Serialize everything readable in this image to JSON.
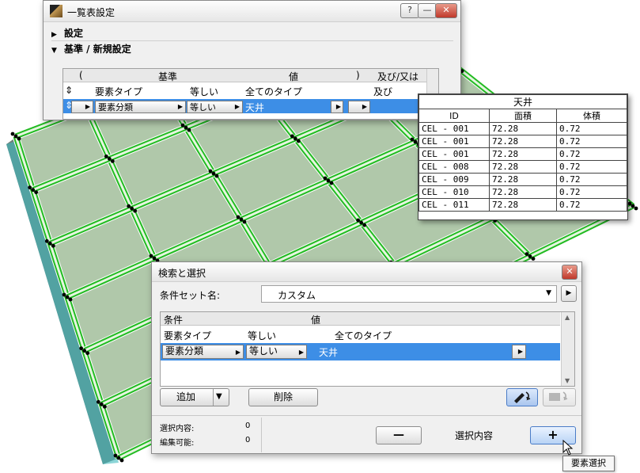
{
  "list_window": {
    "title": "一覧表設定",
    "help_label": "?",
    "minimize_label": "—",
    "close_label": "✕",
    "settings_label": "設定",
    "criteria_label": "基準 / 新規設定",
    "grid_header": {
      "paren_open": "(",
      "criteria": "基準",
      "value": "値",
      "paren_close": ")",
      "and_or": "及び/又は"
    },
    "rows": [
      {
        "sort": "⇕",
        "element_type": "要素タイプ",
        "op": "等しい",
        "value": "全てのタイプ",
        "and_or": "及び"
      },
      {
        "sort": "⇕",
        "element_type": "要素分類",
        "op": "等しい",
        "value": "天井",
        "and_or": ""
      }
    ]
  },
  "ceiling_table": {
    "caption": "天井",
    "headers": [
      "ID",
      "面積",
      "体積"
    ],
    "rows": [
      [
        "CEL - 001",
        "72.28",
        "0.72"
      ],
      [
        "CEL - 001",
        "72.28",
        "0.72"
      ],
      [
        "CEL - 001",
        "72.28",
        "0.72"
      ],
      [
        "CEL - 008",
        "72.28",
        "0.72"
      ],
      [
        "CEL - 009",
        "72.28",
        "0.72"
      ],
      [
        "CEL - 010",
        "72.28",
        "0.72"
      ],
      [
        "CEL - 011",
        "72.28",
        "0.72"
      ]
    ]
  },
  "find_window": {
    "title": "検索と選択",
    "close_label": "✕",
    "set_name_label": "条件セット名:",
    "set_name_value": "カスタム",
    "cond_header": {
      "condition": "条件",
      "value": "値"
    },
    "rows": [
      {
        "element_type": "要素タイプ",
        "op": "等しい",
        "value": "全てのタイプ"
      },
      {
        "element_type": "要素分類",
        "op": "等しい",
        "value": "天井"
      }
    ],
    "add_label": "追加",
    "delete_label": "削除",
    "selected_label": "選択内容:",
    "selected_count": "0",
    "editable_label": "編集可能:",
    "editable_count": "0",
    "minus_label": "—",
    "plus_label": "+",
    "selection_label": "選択内容",
    "tooltip": "要素選択"
  },
  "colors": {
    "selection_blue": "#3d8ee6",
    "panel_green": "#b0c8aa",
    "grid_green": "#22bb22",
    "edge_teal": "#5ccfcf"
  }
}
